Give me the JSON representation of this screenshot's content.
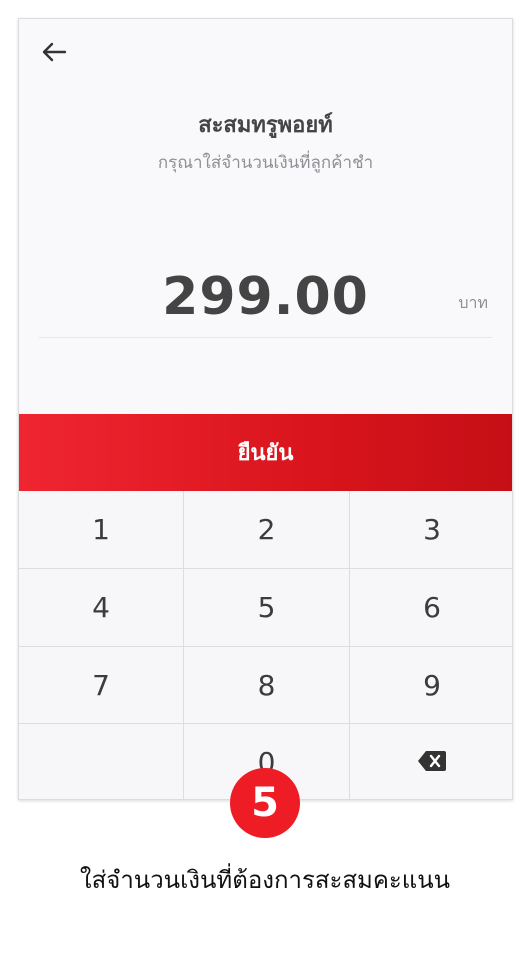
{
  "header": {
    "back_icon": "arrow-left-icon",
    "title": "สะสมทรูพอยท์",
    "subtitle": "กรุณาใส่จำนวนเงินที่ลูกค้าชำ"
  },
  "amount": {
    "value": "299.00",
    "unit": "บาท"
  },
  "confirm_button": {
    "label": "ยืนยัน",
    "color": "#e31b23"
  },
  "keypad": {
    "keys": [
      "1",
      "2",
      "3",
      "4",
      "5",
      "6",
      "7",
      "8",
      "9",
      "",
      "0",
      ""
    ],
    "delete_icon": "backspace-icon"
  },
  "annotation": {
    "step_number": "5",
    "badge_color": "#ee1c25",
    "caption": "ใส่จำนวนเงินที่ต้องการสะสมคะแนน"
  }
}
